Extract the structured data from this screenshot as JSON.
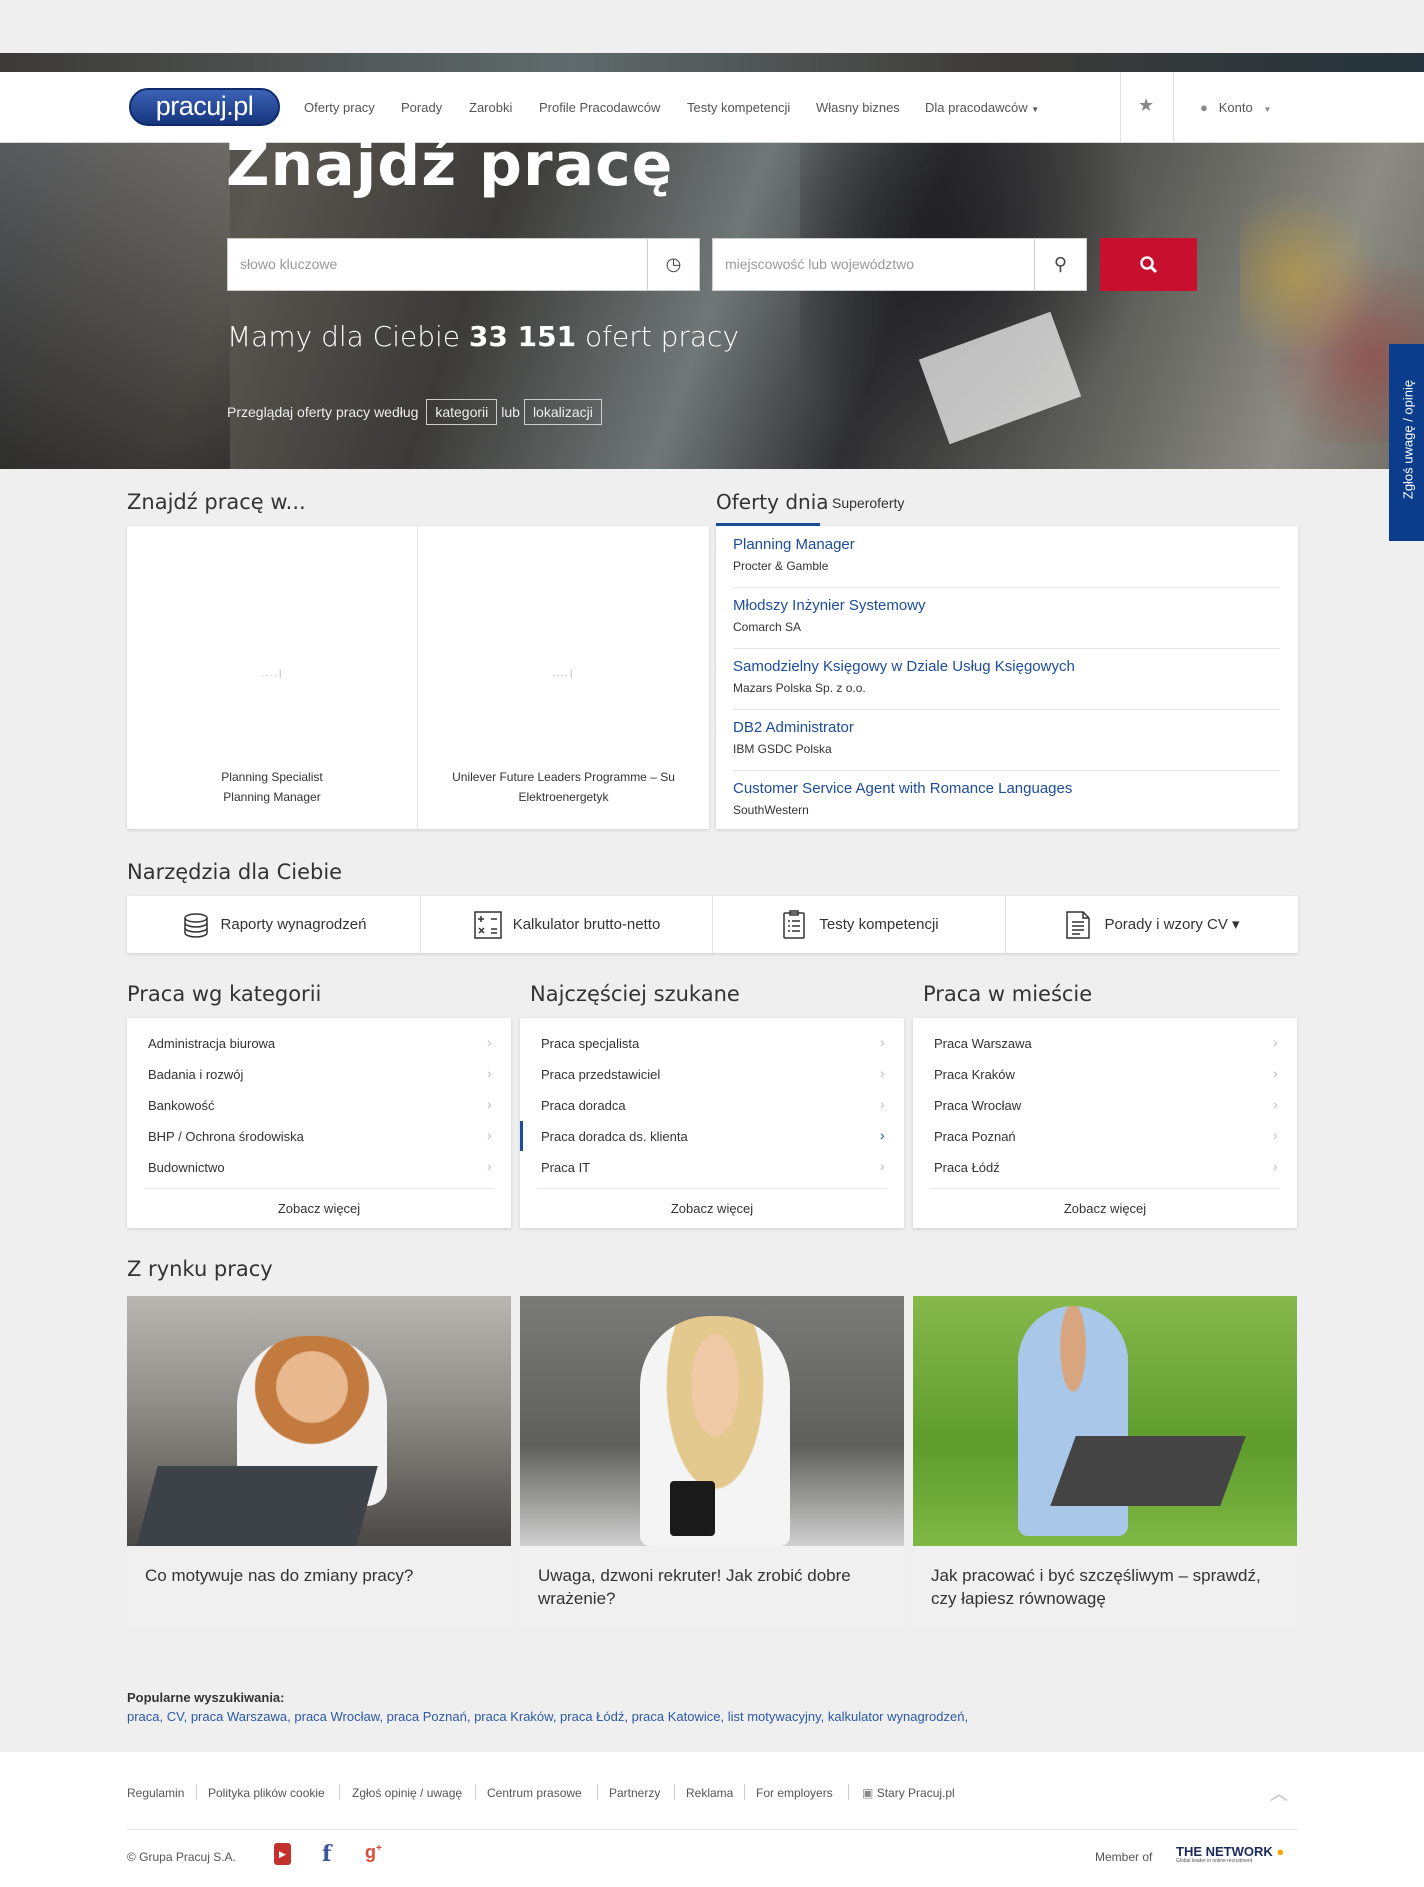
{
  "nav": {
    "logo": "pracuj.pl",
    "items": [
      "Oferty pracy",
      "Porady",
      "Zarobki",
      "Profile Pracodawców",
      "Testy kompetencji",
      "Własny biznes",
      "Dla pracodawców"
    ],
    "account": "Konto"
  },
  "hero": {
    "title": "Znajdź pracę",
    "keyword_placeholder": "słowo kluczowe",
    "location_placeholder": "miejscowość lub województwo",
    "count_prefix": "Mamy dla Ciebie",
    "count_value": "33 151",
    "count_suffix": "ofert pracy",
    "browse_prefix": "Przeglądaj oferty pracy według",
    "browse_category": "kategorii",
    "browse_or": "lub",
    "browse_location": "lokalizacji"
  },
  "feedback": "Zgłoś uwagę / opinię",
  "find_in": {
    "title": "Znajdź pracę w...",
    "tiles": [
      {
        "line1": "Planning Specialist",
        "line2": "Planning Manager"
      },
      {
        "line1": "Unilever Future Leaders Programme – Su",
        "line2": "Elektroenergetyk"
      }
    ]
  },
  "offers": {
    "tab_active": "Oferty dnia",
    "tab_other": "Superoferty",
    "items": [
      {
        "title": "Planning Manager",
        "company": "Procter & Gamble"
      },
      {
        "title": "Młodszy Inżynier Systemowy",
        "company": "Comarch SA"
      },
      {
        "title": "Samodzielny Księgowy w Dziale Usług Księgowych",
        "company": "Mazars Polska Sp. z o.o."
      },
      {
        "title": "DB2 Administrator",
        "company": "IBM GSDC Polska"
      },
      {
        "title": "Customer Service Agent with Romance Languages",
        "company": "SouthWestern"
      }
    ]
  },
  "tools": {
    "title": "Narzędzia dla Ciebie",
    "items": [
      {
        "label": "Raporty wynagrodzeń",
        "icon": "coins-icon"
      },
      {
        "label": "Kalkulator brutto-netto",
        "icon": "calculator-icon"
      },
      {
        "label": "Testy kompetencji",
        "icon": "checklist-icon"
      },
      {
        "label": "Porady i wzory CV ▾",
        "icon": "document-icon"
      }
    ]
  },
  "categories": {
    "title": "Praca wg kategorii",
    "items": [
      "Administracja biurowa",
      "Badania i rozwój",
      "Bankowość",
      "BHP / Ochrona środowiska",
      "Budownictwo"
    ],
    "more": "Zobacz więcej"
  },
  "popular": {
    "title": "Najczęściej szukane",
    "items": [
      "Praca specjalista",
      "Praca przedstawiciel",
      "Praca doradca",
      "Praca doradca ds. klienta",
      "Praca IT"
    ],
    "more": "Zobacz więcej"
  },
  "cities": {
    "title": "Praca w mieście",
    "items": [
      "Praca Warszawa",
      "Praca Kraków",
      "Praca Wrocław",
      "Praca Poznań",
      "Praca Łódź"
    ],
    "more": "Zobacz więcej"
  },
  "market": {
    "title": "Z rynku pracy",
    "articles": [
      "Co motywuje nas do zmiany pracy?",
      "Uwaga, dzwoni rekruter! Jak zrobić dobre wrażenie?",
      "Jak pracować i być szczęśliwym – sprawdź, czy łapiesz równowagę"
    ]
  },
  "popular_searches": {
    "title": "Popularne wyszukiwania:",
    "links": "praca, CV, praca Warszawa, praca Wrocław, praca Poznań, praca Kraków, praca Łódź, praca Katowice, list motywacyjny, kalkulator wynagrodzeń,"
  },
  "footer": {
    "links": [
      "Regulamin",
      "Polityka plików cookie",
      "Zgłoś opinię / uwagę",
      "Centrum prasowe",
      "Partnerzy",
      "Reklama",
      "For employers",
      "Stary Pracuj.pl"
    ],
    "copyright": "© Grupa Pracuj S.A.",
    "member_of": "Member of",
    "network": "THE NETWORK",
    "network_sub": "Global leader in online recruitment"
  },
  "colors": {
    "brand": "#1d4c9a",
    "search_button": "#c8102e",
    "feedback_bg": "#0b3d8c"
  }
}
